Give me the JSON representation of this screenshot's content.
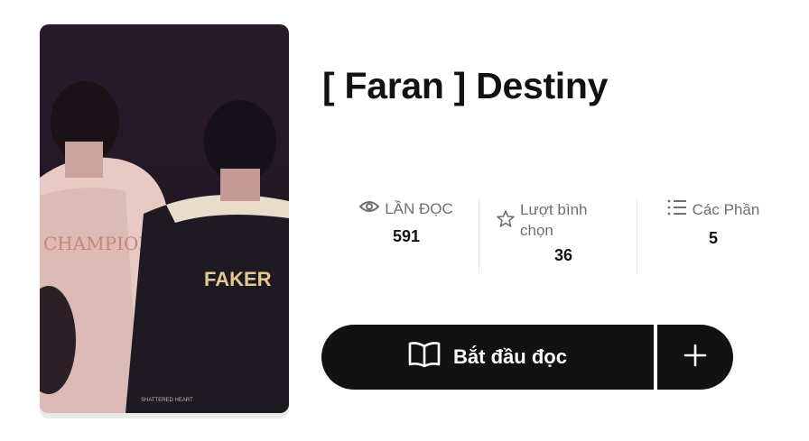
{
  "story": {
    "title": "[ Faran ] Destiny",
    "cover_alt": "Book cover"
  },
  "stats": {
    "reads": {
      "label": "LẦN ĐỌC",
      "value": "591",
      "icon": "eye-icon"
    },
    "votes": {
      "label_line1": "Lượt bình",
      "label_line2": "chọn",
      "value": "36",
      "icon": "star-icon"
    },
    "parts": {
      "label": "Các Phần",
      "value": "5",
      "icon": "list-icon"
    }
  },
  "actions": {
    "start_label": "Bắt đầu đọc",
    "start_icon": "open-book-icon",
    "add_icon": "plus-icon"
  },
  "cover_text": {
    "jersey_back": "FAKER",
    "left_print": "CHAMPIONS",
    "footer": "SHATTERED HEART"
  },
  "colors": {
    "primary": "#121212",
    "muted": "#6f6f6f",
    "divider": "#e6e6e6"
  }
}
